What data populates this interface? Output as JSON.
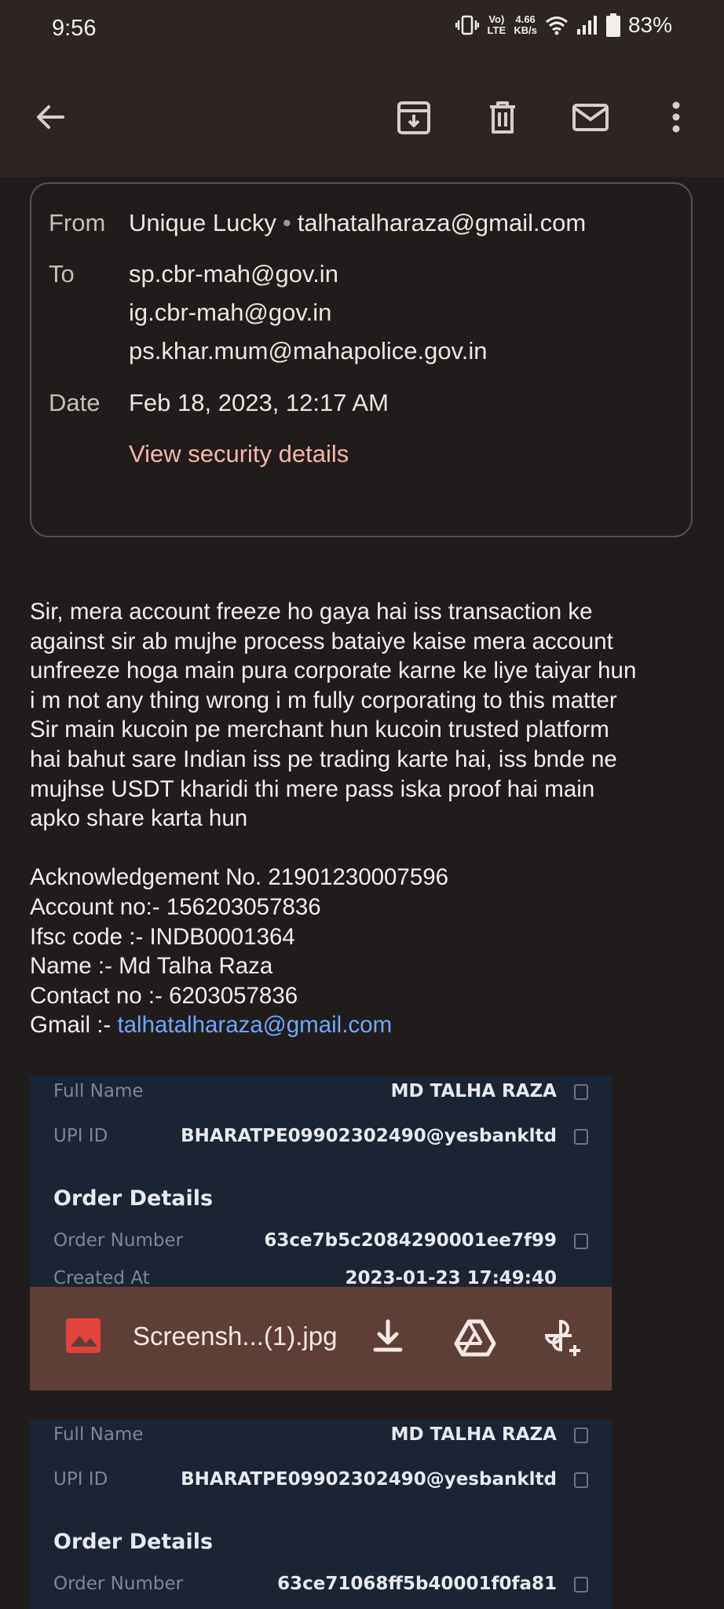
{
  "status_bar": {
    "time": "9:56",
    "volte": "Vo) LTE",
    "speed_value": "4.66",
    "speed_unit": "KB/s",
    "battery": "83%"
  },
  "toolbar": {
    "back_icon": "arrow-back-icon",
    "archive_icon": "archive-icon",
    "delete_icon": "trash-icon",
    "mark_unread_icon": "mail-icon",
    "more_icon": "more-vert-icon"
  },
  "header_details": {
    "from_label": "From",
    "from_name": "Unique Lucky",
    "from_separator": "•",
    "from_email": "talhatalharaza@gmail.com",
    "to_label": "To",
    "to": [
      "sp.cbr-mah@gov.in",
      "ig.cbr-mah@gov.in",
      "ps.khar.mum@mahapolice.gov.in"
    ],
    "date_label": "Date",
    "date": "Feb 18, 2023, 12:17 AM",
    "security_link": "View security details"
  },
  "body": {
    "paragraph_lines": [
      "Sir, mera account freeze ho gaya hai iss transaction ke",
      "against sir ab mujhe process bataiye kaise mera account",
      "unfreeze hoga main pura corporate karne ke liye taiyar hun",
      "i m not any thing wrong i m fully corporating to this matter",
      "Sir main kucoin pe merchant hun kucoin trusted platform",
      "hai bahut sare Indian iss pe trading karte hai, iss bnde ne",
      "mujhse USDT kharidi thi mere pass iska proof hai main",
      "apko share karta hun"
    ],
    "ack": "Acknowledgement No. 21901230007596",
    "account": "Account no:- 156203057836",
    "ifsc": "Ifsc code :- INDB0001364",
    "name": "Name :- Md Talha Raza",
    "contact": "Contact no :- 6203057836",
    "gmail_label": "Gmail :- ",
    "gmail_link": "talhatalharaza@gmail.com"
  },
  "attachment1": {
    "full_name_label": "Full Name",
    "full_name": "MD TALHA RAZA",
    "upi_label": "UPI ID",
    "upi": "BHARATPE09902302490@yesbankltd",
    "order_heading": "Order Details",
    "order_label": "Order Number",
    "order": "63ce7b5c2084290001ee7f99",
    "created_label": "Created At",
    "created": "2023-01-23 17:49:40"
  },
  "attachment_chip": {
    "filename": "Screensh...(1).jpg",
    "image_icon": "image-icon",
    "download_icon": "download-icon",
    "drive_icon": "drive-icon",
    "photos_icon": "add-to-photos-icon"
  },
  "attachment2": {
    "full_name_label": "Full Name",
    "full_name": "MD TALHA RAZA",
    "upi_label": "UPI ID",
    "upi": "BHARATPE09902302490@yesbankltd",
    "order_heading": "Order Details",
    "order_label": "Order Number",
    "order": "63ce71068ff5b40001f0fa81"
  }
}
